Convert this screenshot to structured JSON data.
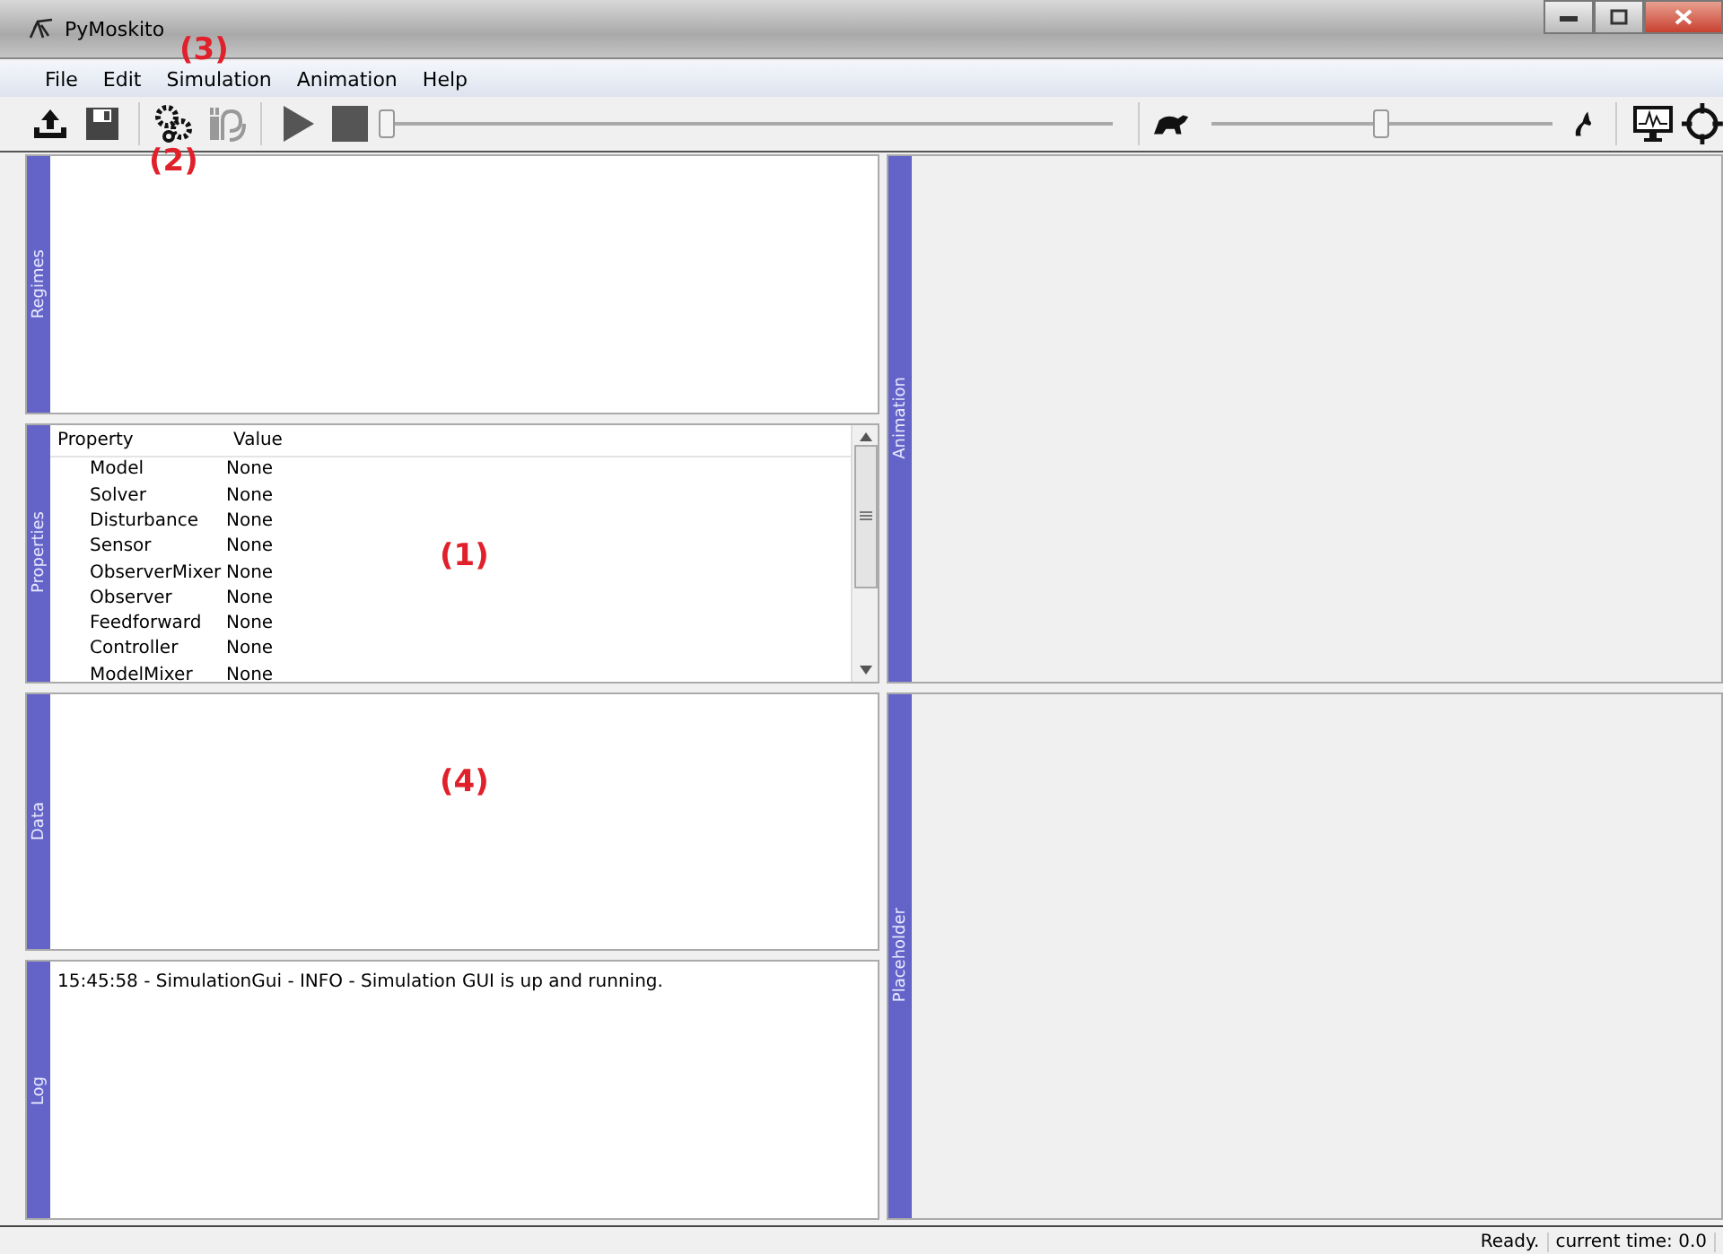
{
  "window": {
    "title": "PyMoskito"
  },
  "menu": [
    "File",
    "Edit",
    "Simulation",
    "Animation",
    "Help"
  ],
  "toolbar": {
    "progress_slider": {
      "level": 0
    },
    "speed_slider": {
      "level": 0.5
    }
  },
  "docks_left": [
    {
      "title": "Regimes",
      "kind": "list"
    },
    {
      "title": "Properties",
      "kind": "properties"
    },
    {
      "title": "Data",
      "kind": "list"
    },
    {
      "title": "Log",
      "kind": "log"
    }
  ],
  "docks_right": [
    {
      "title": "Animation"
    },
    {
      "title": "Placeholder"
    }
  ],
  "properties": {
    "columns": [
      "Property",
      "Value"
    ],
    "rows": [
      {
        "property": "Model",
        "value": "None"
      },
      {
        "property": "Solver",
        "value": "None"
      },
      {
        "property": "Disturbance",
        "value": "None"
      },
      {
        "property": "Sensor",
        "value": "None"
      },
      {
        "property": "ObserverMixer",
        "value": "None"
      },
      {
        "property": "Observer",
        "value": "None"
      },
      {
        "property": "Feedforward",
        "value": "None"
      },
      {
        "property": "Controller",
        "value": "None"
      },
      {
        "property": "ModelMixer",
        "value": "None"
      }
    ]
  },
  "log": [
    "15:45:58 - SimulationGui - INFO - Simulation GUI is up and running."
  ],
  "status_bar": [
    "Ready.",
    "current time: 0.0"
  ],
  "annotations": [
    "(3)",
    "(2)",
    "(1)",
    "(4)"
  ]
}
